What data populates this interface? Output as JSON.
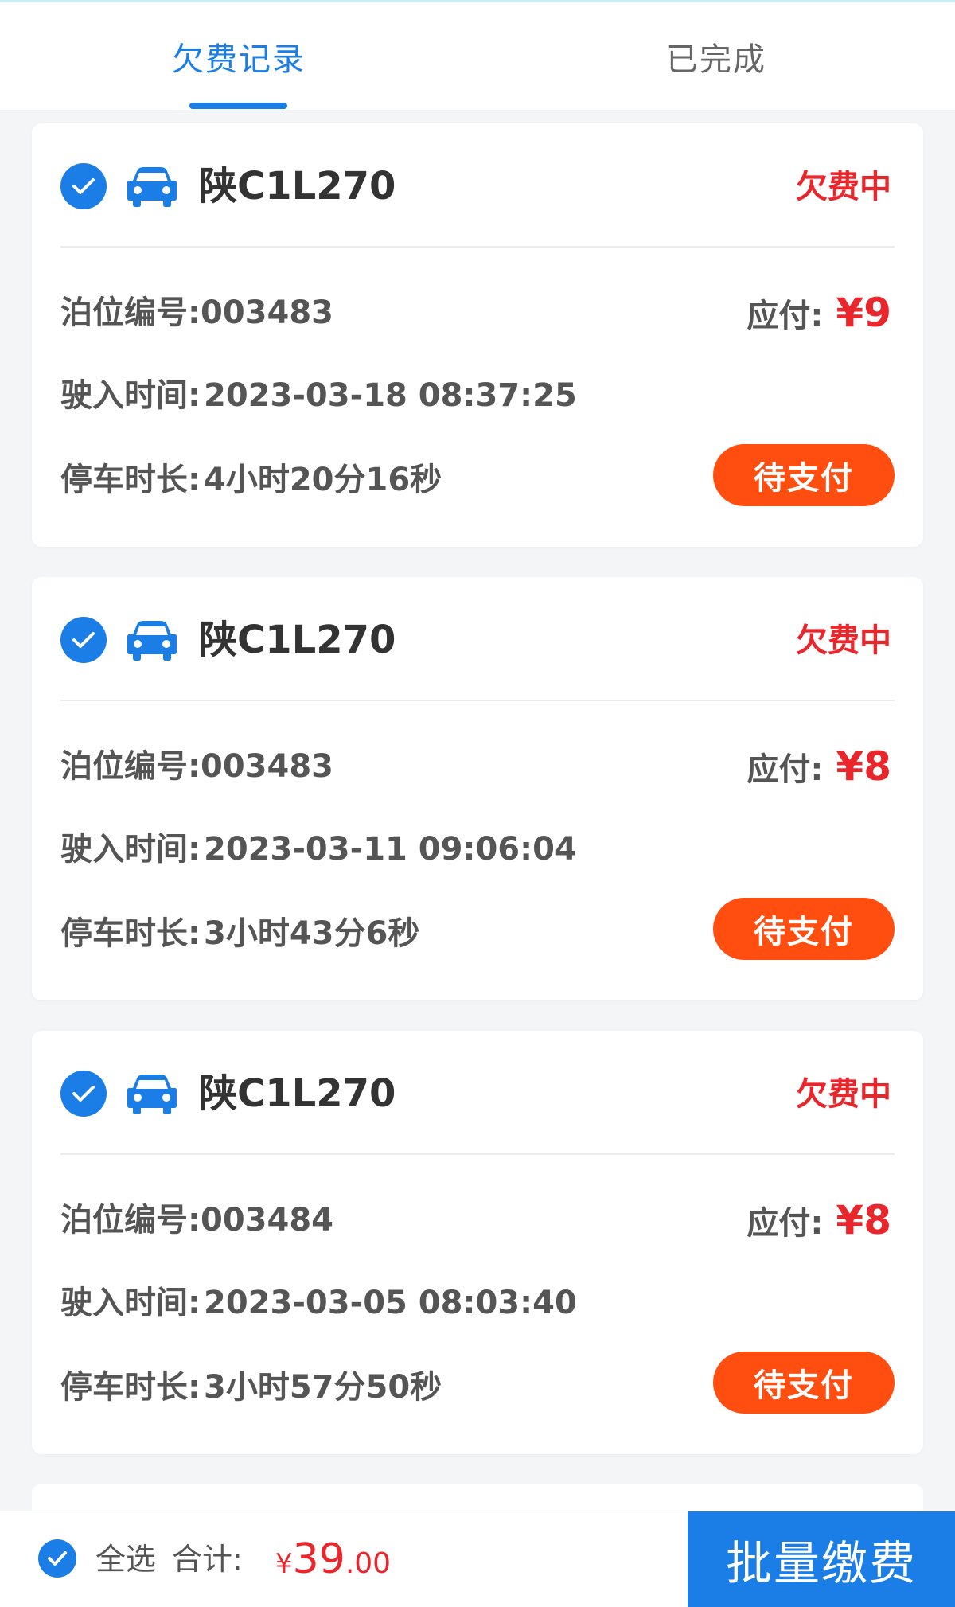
{
  "tabs": [
    {
      "label": "欠费记录"
    },
    {
      "label": "已完成"
    }
  ],
  "records": [
    {
      "plate": "陕C1L270",
      "status": "欠费中",
      "berth_label": "泊位编号:",
      "berth": "003483",
      "due_label": "应付:",
      "due_amount": "¥9",
      "entry_label": "驶入时间:",
      "entry_time": "2023-03-18 08:37:25",
      "duration_label": "停车时长:",
      "duration": "4小时20分16秒",
      "pay_label": "待支付"
    },
    {
      "plate": "陕C1L270",
      "status": "欠费中",
      "berth_label": "泊位编号:",
      "berth": "003483",
      "due_label": "应付:",
      "due_amount": "¥8",
      "entry_label": "驶入时间:",
      "entry_time": "2023-03-11 09:06:04",
      "duration_label": "停车时长:",
      "duration": "3小时43分6秒",
      "pay_label": "待支付"
    },
    {
      "plate": "陕C1L270",
      "status": "欠费中",
      "berth_label": "泊位编号:",
      "berth": "003484",
      "due_label": "应付:",
      "due_amount": "¥8",
      "entry_label": "驶入时间:",
      "entry_time": "2023-03-05 08:03:40",
      "duration_label": "停车时长:",
      "duration": "3小时57分50秒",
      "pay_label": "待支付"
    }
  ],
  "footer": {
    "select_all": "全选",
    "total_label": "合计:",
    "currency": "¥",
    "total_integer": "39",
    "total_decimal": ".00",
    "batch_pay": "批量缴费"
  },
  "colors": {
    "accent": "#1a7ee6",
    "alert": "#e8262c",
    "pay_button": "#ff4e10"
  }
}
